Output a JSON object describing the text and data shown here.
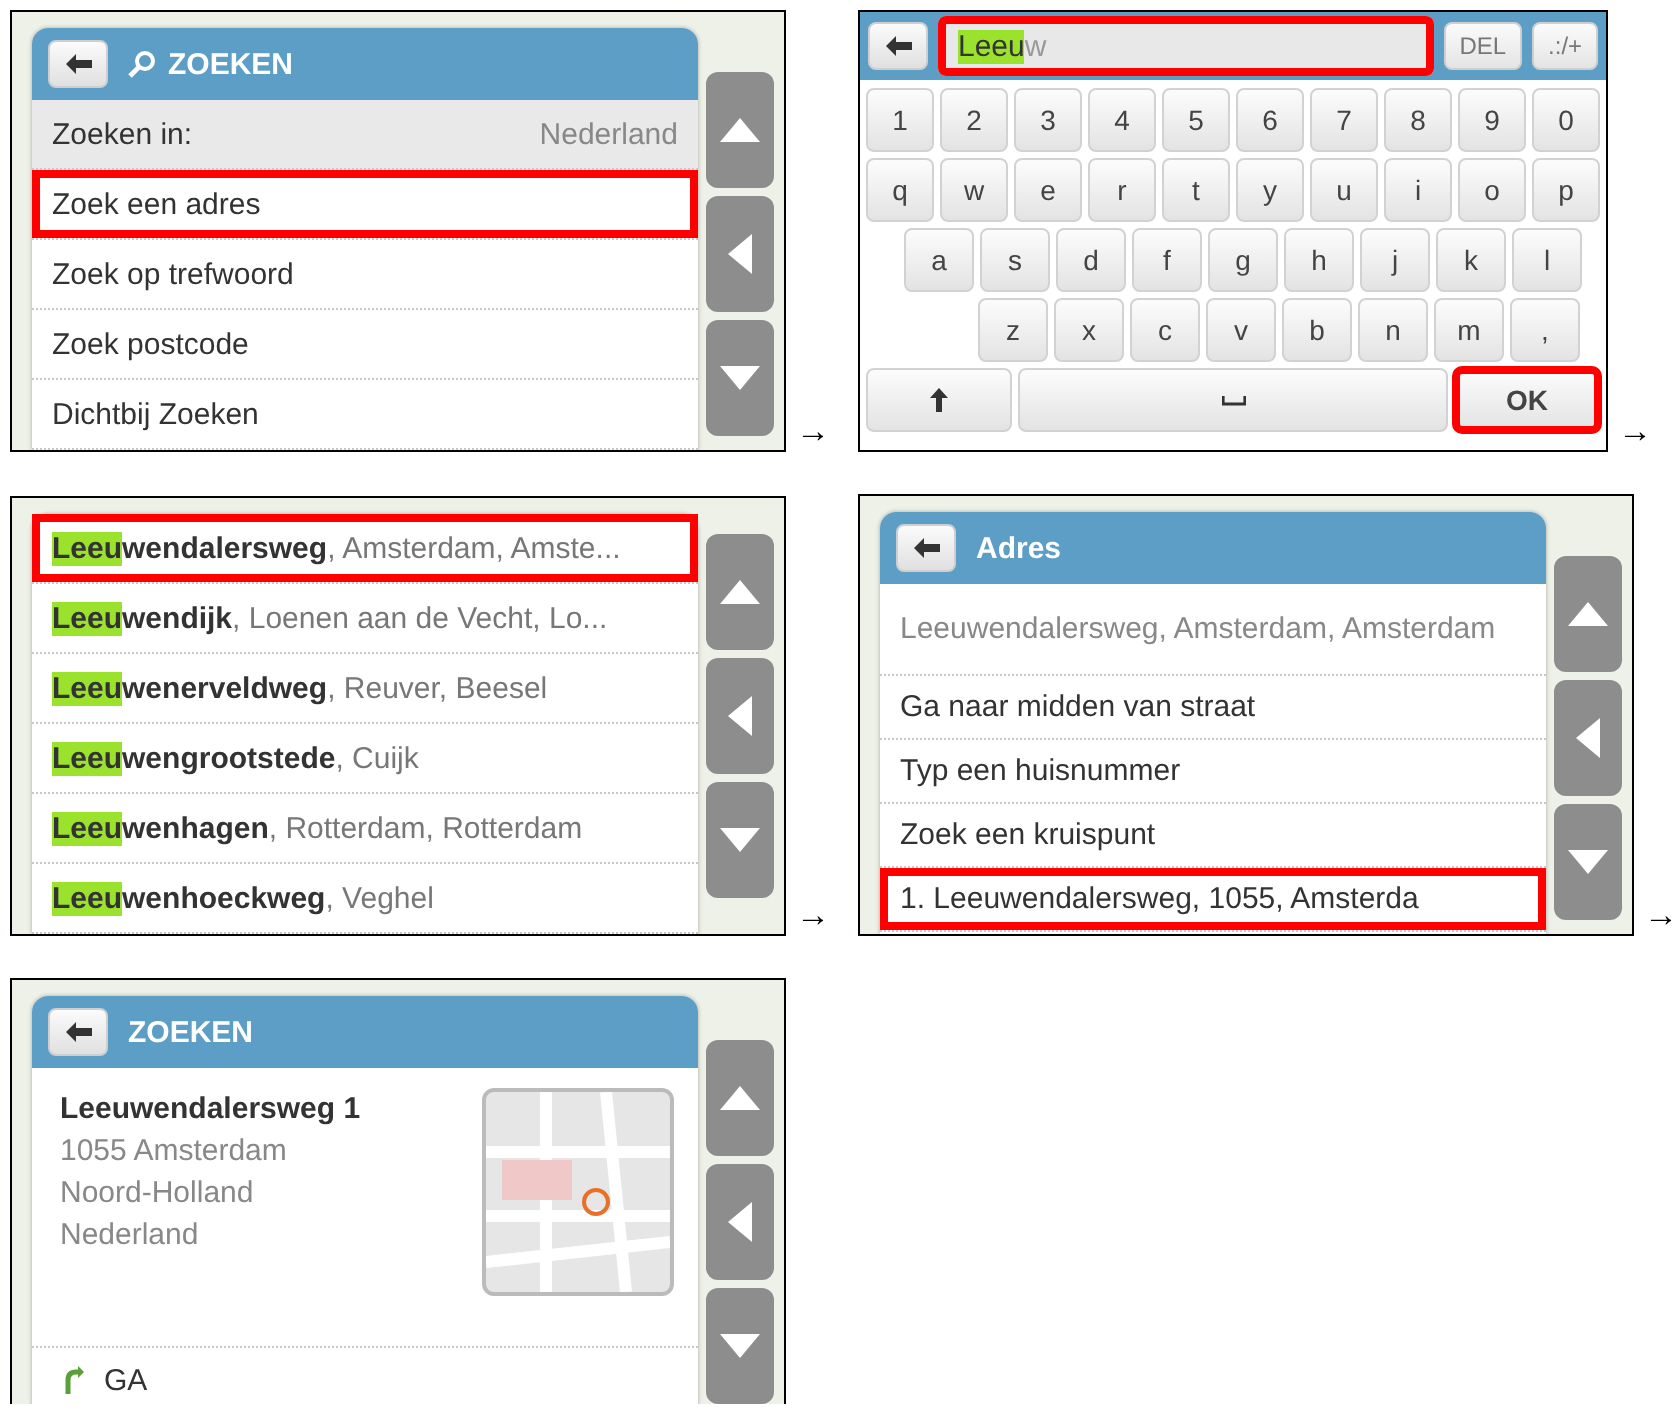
{
  "page_rows": [
    {
      "screens": [
        {
          "kind": "menu",
          "arrow": "→",
          "header": {
            "title": "ZOEKEN",
            "search_icon": true
          },
          "rows": [
            {
              "kind": "setting",
              "label": "Zoeken in:",
              "value": "Nederland",
              "highlighted": false
            },
            {
              "kind": "item",
              "label": "Zoek een adres",
              "highlighted": true
            },
            {
              "kind": "item",
              "label": "Zoek op trefwoord",
              "highlighted": false
            },
            {
              "kind": "item",
              "label": "Zoek postcode",
              "highlighted": false
            },
            {
              "kind": "item",
              "label": "Dichtbij Zoeken",
              "highlighted": false
            }
          ]
        },
        {
          "kind": "keyboard",
          "arrow": "→",
          "field": {
            "typed": "Leeu",
            "suggestion": "w",
            "highlighted": true
          },
          "top_keys": [
            "DEL",
            ".:/+"
          ],
          "key_rows": [
            [
              "1",
              "2",
              "3",
              "4",
              "5",
              "6",
              "7",
              "8",
              "9",
              "0"
            ],
            [
              "q",
              "w",
              "e",
              "r",
              "t",
              "y",
              "u",
              "i",
              "o",
              "p"
            ],
            [
              "a",
              "s",
              "d",
              "f",
              "g",
              "h",
              "j",
              "k",
              "l"
            ],
            [
              "z",
              "x",
              "c",
              "v",
              "b",
              "n",
              "m",
              ","
            ]
          ],
          "ok": {
            "label": "OK",
            "highlighted": true
          }
        }
      ]
    },
    {
      "screens": [
        {
          "kind": "results",
          "arrow": "→",
          "rows": [
            {
              "match": "Leeu",
              "rest": "wendalersweg",
              "detail": ", Amsterdam, Amste...",
              "highlighted": true
            },
            {
              "match": "Leeu",
              "rest": "wendijk",
              "detail": ", Loenen aan de Vecht, Lo...",
              "highlighted": false
            },
            {
              "match": "Leeu",
              "rest": "wenerveldweg",
              "detail": ", Reuver, Beesel",
              "highlighted": false
            },
            {
              "match": "Leeu",
              "rest": "wengrootstede",
              "detail": ", Cuijk",
              "highlighted": false
            },
            {
              "match": "Leeu",
              "rest": "wenhagen",
              "detail": ", Rotterdam, Rotterdam",
              "highlighted": false
            },
            {
              "match": "Leeu",
              "rest": "wenhoeckweg",
              "detail": ", Veghel",
              "highlighted": false
            }
          ]
        },
        {
          "kind": "menu",
          "arrow": "→",
          "header": {
            "title": "Adres",
            "search_icon": false
          },
          "rows": [
            {
              "kind": "info",
              "label": "Leeuwendalersweg, Amsterdam, Amsterdam",
              "highlighted": false
            },
            {
              "kind": "item",
              "label": "Ga naar midden van straat",
              "highlighted": false
            },
            {
              "kind": "item",
              "label": "Typ een huisnummer",
              "highlighted": false
            },
            {
              "kind": "item",
              "label": "Zoek een kruispunt",
              "highlighted": false
            },
            {
              "kind": "item",
              "label": "1. Leeuwendalersweg, 1055, Amsterda",
              "highlighted": true
            }
          ]
        }
      ]
    },
    {
      "screens": [
        {
          "kind": "details",
          "header": {
            "title": "ZOEKEN",
            "search_icon": false
          },
          "name": "Leeuwendalersweg 1",
          "lines": [
            "1055 Amsterdam",
            "Noord-Holland",
            "Nederland"
          ],
          "action": "GA"
        }
      ]
    }
  ]
}
